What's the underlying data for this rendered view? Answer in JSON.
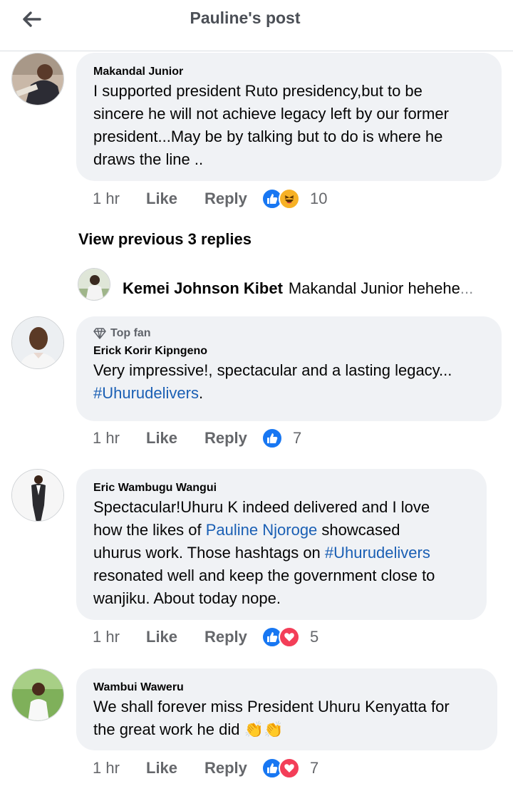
{
  "header": {
    "title": "Pauline's post",
    "back_icon": "arrow-left-icon"
  },
  "view_previous": "View previous 3 replies",
  "collapsed_reply": {
    "author": "Kemei Johnson Kibet",
    "text": "Makandal Junior hehehe",
    "more": "..."
  },
  "comments": [
    {
      "author": "Makandal Junior",
      "lines": [
        "I supported president Ruto presidency,but to be",
        "sincere he will not achieve legacy left by our former",
        "president...May be by talking but to do is where he",
        "draws the line .."
      ],
      "time": "1 hr",
      "like": "Like",
      "reply": "Reply",
      "reactions": [
        "like-reaction-icon",
        "haha-reaction-icon"
      ],
      "count": "10"
    },
    {
      "badge": "Top fan",
      "author": "Erick Korir Kipngeno",
      "lines": [
        "Very impressive!, spectacular and a lasting legacy..."
      ],
      "hashtag": "#Uhurudelivers",
      "after_hashtag": ".",
      "time": "1 hr",
      "like": "Like",
      "reply": "Reply",
      "reactions": [
        "like-reaction-icon"
      ],
      "count": "7"
    },
    {
      "author": "Eric Wambugu Wangui",
      "line1": "Spectacular!Uhuru K indeed delivered and I love",
      "line2_before": "how the likes of ",
      "line2_link": "Pauline Njoroge",
      "line2_after": " showcased",
      "line3_before": "uhurus work. Those hashtags on ",
      "line3_link": "#Uhurudelivers",
      "line4": "resonated well and keep the government close to",
      "line5": "wanjiku. About today nope.",
      "time": "1 hr",
      "like": "Like",
      "reply": "Reply",
      "reactions": [
        "like-reaction-icon",
        "love-reaction-icon"
      ],
      "count": "5"
    },
    {
      "author": "Wambui Waweru",
      "lines": [
        "We shall forever miss President Uhuru Kenyatta for",
        "the great work he did"
      ],
      "emoji": "👏👏",
      "time": "1 hr",
      "like": "Like",
      "reply": "Reply",
      "reactions": [
        "like-reaction-icon",
        "love-reaction-icon"
      ],
      "count": "7"
    }
  ],
  "colors": {
    "bubble": "#f0f2f5",
    "link": "#1a5fb4",
    "like_blue": "#1877f2",
    "love_red": "#f33e58",
    "muted": "#65676b"
  }
}
